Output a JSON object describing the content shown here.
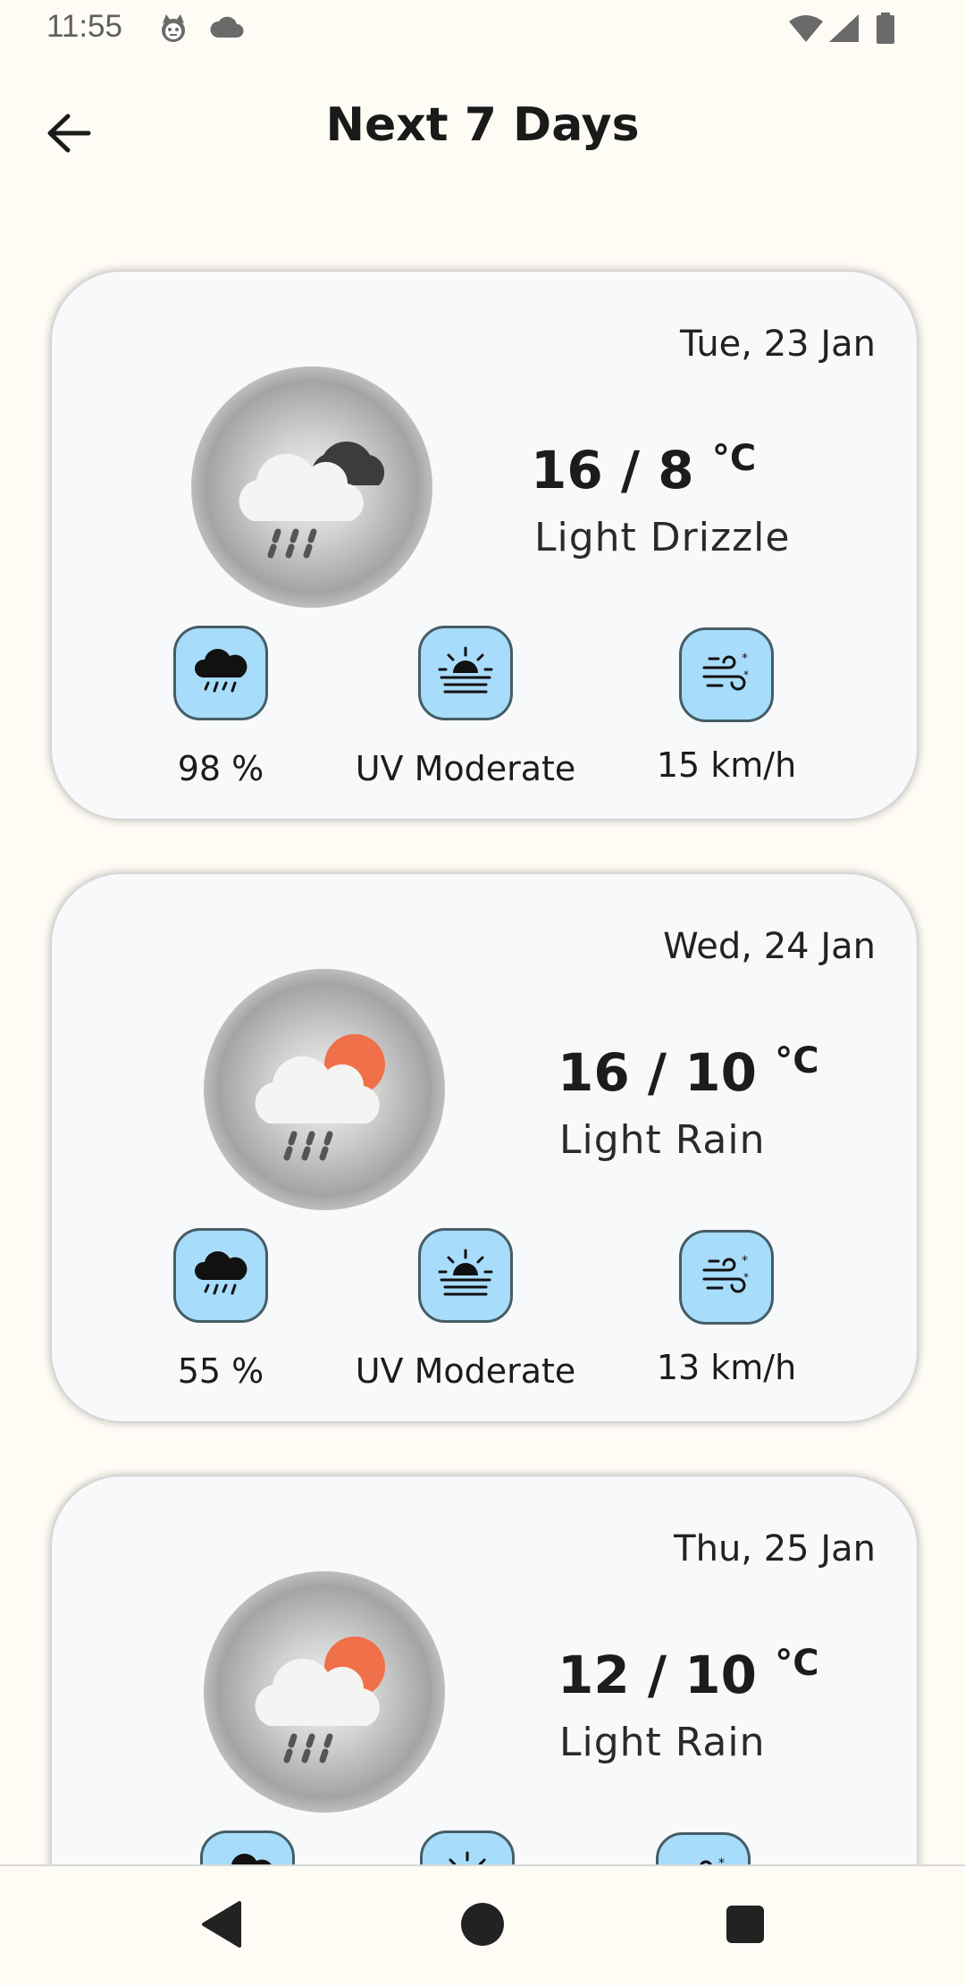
{
  "status_bar": {
    "time": "11:55",
    "left_icons": [
      "cat-face-icon",
      "cloud-icon"
    ],
    "right_icons": [
      "wifi-icon",
      "signal-icon",
      "battery-icon"
    ]
  },
  "app_bar": {
    "back_icon": "arrow-left-icon",
    "title": "Next 7 Days"
  },
  "days": [
    {
      "date": "Tue, 23 Jan",
      "icon": "cloudy-rain-icon",
      "temp_high": "16",
      "temp_low": "8",
      "unit": "°C",
      "condition": "Light Drizzle",
      "precip": "98 %",
      "uv": "UV Moderate",
      "wind": "15 km/h"
    },
    {
      "date": "Wed, 24 Jan",
      "icon": "sun-cloud-rain-icon",
      "temp_high": "16",
      "temp_low": "10",
      "unit": "°C",
      "condition": "Light Rain",
      "precip": "55 %",
      "uv": "UV Moderate",
      "wind": "13 km/h"
    },
    {
      "date": "Thu, 25 Jan",
      "icon": "sun-cloud-rain-icon",
      "temp_high": "12",
      "temp_low": "10",
      "unit": "°C",
      "condition": "Light Rain"
    }
  ],
  "colors": {
    "background": "#fffcf6",
    "card": "#f8f9fa",
    "stat_icon_bg": "#a8dcfb",
    "stat_icon_border": "#455d66",
    "sun": "#f07049"
  },
  "nav_bar": {
    "icons": [
      "back-triangle-icon",
      "home-circle-icon",
      "recents-square-icon"
    ]
  }
}
